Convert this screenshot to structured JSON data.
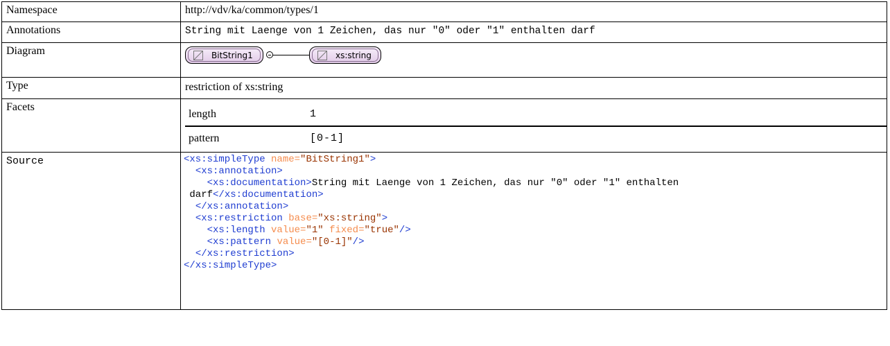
{
  "labels": {
    "namespace": "Namespace",
    "annotations": "Annotations",
    "diagram": "Diagram",
    "type": "Type",
    "facets": "Facets",
    "source": "Source"
  },
  "namespace": "http://vdv/ka/common/types/1",
  "annotation": "String mit Laenge von 1 Zeichen, das nur \"0\" oder \"1\" enthalten darf",
  "diagram": {
    "node1": "BitString1",
    "node2": "xs:string",
    "node_fill": "#e6d2ec",
    "node_icon": "simple-type-triangle-icon"
  },
  "type": "restriction of xs:string",
  "facets": [
    {
      "name": "length",
      "value": "1"
    },
    {
      "name": "pattern",
      "value": "[0-1]"
    }
  ],
  "source": {
    "colors": {
      "tag": "#1f3dd1",
      "attr": "#f58c4d",
      "value": "#993300"
    },
    "l1_tag": "<xs:simpleType",
    "l1_attr": "name=",
    "l1_val": "\"BitString1\"",
    "l1_end": ">",
    "l2_tag": "<xs:annotation>",
    "l3_tag": "<xs:documentation>",
    "l3_text": "String mit Laenge von 1 Zeichen, das nur \"0\" oder \"1\" enthalten",
    "l4_text": "darf",
    "l4_tag": "</xs:documentation>",
    "l5_tag": "</xs:annotation>",
    "l6_tag": "<xs:restriction",
    "l6_attr": "base=",
    "l6_val": "\"xs:string\"",
    "l6_end": ">",
    "l7_tag": "<xs:length",
    "l7_attr1": "value=",
    "l7_val1": "\"1\"",
    "l7_attr2": "fixed=",
    "l7_val2": "\"true\"",
    "l7_end": "/>",
    "l8_tag": "<xs:pattern",
    "l8_attr": "value=",
    "l8_val": "\"[0-1]\"",
    "l8_end": "/>",
    "l9_tag": "</xs:restriction>",
    "l10_tag": "</xs:simpleType>"
  }
}
